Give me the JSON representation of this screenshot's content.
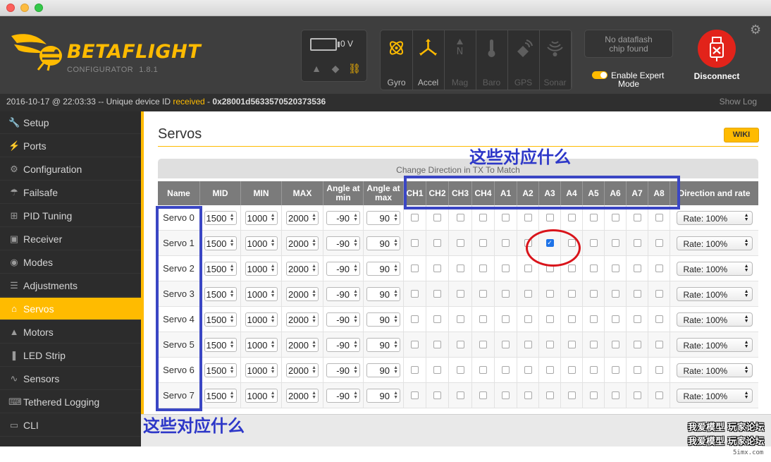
{
  "window": {
    "title": ""
  },
  "header": {
    "brand": "BETAFLIGHT",
    "subtitle": "CONFIGURATOR",
    "version": "1.8.1",
    "voltage": "0 V",
    "sensors": [
      {
        "name": "gyro-icon",
        "label": "Gyro",
        "active": true
      },
      {
        "name": "accel-icon",
        "label": "Accel",
        "active": true
      },
      {
        "name": "mag-icon",
        "label": "Mag",
        "active": false
      },
      {
        "name": "baro-icon",
        "label": "Baro",
        "active": false
      },
      {
        "name": "gps-icon",
        "label": "GPS",
        "active": false
      },
      {
        "name": "sonar-icon",
        "label": "Sonar",
        "active": false
      }
    ],
    "dataflash_line1": "No dataflash",
    "dataflash_line2": "chip found",
    "expert_line1": "Enable Expert",
    "expert_line2": "Mode",
    "expert_on": true,
    "disconnect_label": "Disconnect",
    "accent": "#ffbb00",
    "disconnect_color": "#e2231a"
  },
  "status": {
    "prefix": "2016-10-17 @ 22:03:33 -- Unique device ID",
    "received": "received",
    "dash": "-",
    "device_id": "0x28001d5633570520373536",
    "show_log": "Show Log"
  },
  "sidebar": {
    "items": [
      {
        "label": "Setup",
        "icon": "wrench-icon",
        "active": false
      },
      {
        "label": "Ports",
        "icon": "plug-icon",
        "active": false
      },
      {
        "label": "Configuration",
        "icon": "gear-icon",
        "active": false
      },
      {
        "label": "Failsafe",
        "icon": "parachute-icon",
        "active": false
      },
      {
        "label": "PID Tuning",
        "icon": "sitemap-icon",
        "active": false
      },
      {
        "label": "Receiver",
        "icon": "receiver-icon",
        "active": false
      },
      {
        "label": "Modes",
        "icon": "toggle-icon",
        "active": false
      },
      {
        "label": "Adjustments",
        "icon": "sliders-icon",
        "active": false
      },
      {
        "label": "Servos",
        "icon": "servo-icon",
        "active": true
      },
      {
        "label": "Motors",
        "icon": "motor-icon",
        "active": false
      },
      {
        "label": "LED Strip",
        "icon": "led-icon",
        "active": false
      },
      {
        "label": "Sensors",
        "icon": "pulse-icon",
        "active": false
      },
      {
        "label": "Tethered Logging",
        "icon": "keyboard-icon",
        "active": false
      },
      {
        "label": "CLI",
        "icon": "terminal-icon",
        "active": false
      }
    ]
  },
  "page": {
    "title": "Servos",
    "wiki": "WIKI",
    "change_direction": "Change Direction in TX To Match",
    "headers": {
      "name": "Name",
      "mid": "MID",
      "min": "MIN",
      "max": "MAX",
      "angle_min": "Angle at min",
      "angle_max": "Angle at max",
      "channels": [
        "CH1",
        "CH2",
        "CH3",
        "CH4",
        "A1",
        "A2",
        "A3",
        "A4",
        "A5",
        "A6",
        "A7",
        "A8"
      ],
      "direction": "Direction and rate"
    },
    "rows": [
      {
        "name": "Servo 0",
        "mid": "1500",
        "min": "1000",
        "max": "2000",
        "amin": "-90",
        "amax": "90",
        "checked": [],
        "rate": "Rate: 100%"
      },
      {
        "name": "Servo 1",
        "mid": "1500",
        "min": "1000",
        "max": "2000",
        "amin": "-90",
        "amax": "90",
        "checked": [
          "A3"
        ],
        "rate": "Rate: 100%"
      },
      {
        "name": "Servo 2",
        "mid": "1500",
        "min": "1000",
        "max": "2000",
        "amin": "-90",
        "amax": "90",
        "checked": [],
        "rate": "Rate: 100%"
      },
      {
        "name": "Servo 3",
        "mid": "1500",
        "min": "1000",
        "max": "2000",
        "amin": "-90",
        "amax": "90",
        "checked": [],
        "rate": "Rate: 100%"
      },
      {
        "name": "Servo 4",
        "mid": "1500",
        "min": "1000",
        "max": "2000",
        "amin": "-90",
        "amax": "90",
        "checked": [],
        "rate": "Rate: 100%"
      },
      {
        "name": "Servo 5",
        "mid": "1500",
        "min": "1000",
        "max": "2000",
        "amin": "-90",
        "amax": "90",
        "checked": [],
        "rate": "Rate: 100%"
      },
      {
        "name": "Servo 6",
        "mid": "1500",
        "min": "1000",
        "max": "2000",
        "amin": "-90",
        "amax": "90",
        "checked": [],
        "rate": "Rate: 100%"
      },
      {
        "name": "Servo 7",
        "mid": "1500",
        "min": "1000",
        "max": "2000",
        "amin": "-90",
        "amax": "90",
        "checked": [],
        "rate": "Rate: 100%"
      }
    ]
  },
  "annotations": {
    "top_text": "这些对应什么",
    "left_text": "这些对应什么",
    "box_color": "#3a46c4",
    "circle_color": "#d9141b"
  },
  "watermark": {
    "line1": "我爱模型 玩家论坛",
    "line2": "我爱模型 玩家论坛",
    "site": "5imx.com"
  }
}
